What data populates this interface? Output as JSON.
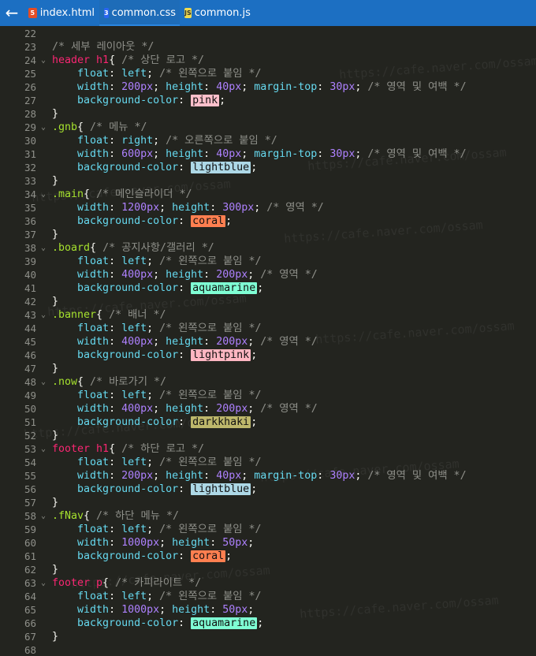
{
  "tabs": [
    {
      "label": "index.html",
      "icon": "html-file-icon",
      "type": "html"
    },
    {
      "label": "common.css",
      "icon": "css-file-icon",
      "type": "css"
    },
    {
      "label": "common.js",
      "icon": "js-file-icon",
      "type": "js"
    }
  ],
  "back_glyph": "←",
  "watermark": "https://cafe.naver.com/ossam",
  "lines": [
    {
      "n": "22",
      "fold": "",
      "seg": []
    },
    {
      "n": "23",
      "fold": "",
      "seg": [
        [
          "cmt",
          "/* 세부 레이아웃 */"
        ]
      ]
    },
    {
      "n": "24",
      "fold": "⌄",
      "seg": [
        [
          "tag",
          "header h1"
        ],
        [
          "",
          "{ "
        ],
        [
          "cmt",
          "/* 상단 로고 */"
        ]
      ]
    },
    {
      "n": "25",
      "fold": "",
      "seg": [
        [
          "",
          "    "
        ],
        [
          "prop",
          "float"
        ],
        [
          "",
          ": "
        ],
        [
          "val",
          "left"
        ],
        [
          "",
          "; "
        ],
        [
          "cmt",
          "/* 왼쪽으로 붙임 */"
        ]
      ]
    },
    {
      "n": "26",
      "fold": "",
      "seg": [
        [
          "",
          "    "
        ],
        [
          "prop",
          "width"
        ],
        [
          "",
          ": "
        ],
        [
          "num",
          "200px"
        ],
        [
          "",
          "; "
        ],
        [
          "prop",
          "height"
        ],
        [
          "",
          ": "
        ],
        [
          "num",
          "40px"
        ],
        [
          "",
          "; "
        ],
        [
          "prop",
          "margin-top"
        ],
        [
          "",
          ": "
        ],
        [
          "num",
          "30px"
        ],
        [
          "",
          "; "
        ],
        [
          "cmt",
          "/* 영역 및 여백 */"
        ]
      ]
    },
    {
      "n": "27",
      "fold": "",
      "seg": [
        [
          "",
          "    "
        ],
        [
          "prop",
          "background-color"
        ],
        [
          "",
          ": "
        ],
        [
          "sw:#ffc0cb",
          "pink"
        ],
        [
          "",
          ";"
        ]
      ]
    },
    {
      "n": "28",
      "fold": "",
      "seg": [
        [
          "",
          "}"
        ]
      ]
    },
    {
      "n": "29",
      "fold": "⌄",
      "seg": [
        [
          "cls",
          ".gnb"
        ],
        [
          "",
          "{ "
        ],
        [
          "cmt",
          "/* 메뉴 */"
        ]
      ]
    },
    {
      "n": "30",
      "fold": "",
      "seg": [
        [
          "",
          "    "
        ],
        [
          "prop",
          "float"
        ],
        [
          "",
          ": "
        ],
        [
          "val",
          "right"
        ],
        [
          "",
          "; "
        ],
        [
          "cmt",
          "/* 오른쪽으로 붙임 */"
        ]
      ]
    },
    {
      "n": "31",
      "fold": "",
      "seg": [
        [
          "",
          "    "
        ],
        [
          "prop",
          "width"
        ],
        [
          "",
          ": "
        ],
        [
          "num",
          "600px"
        ],
        [
          "",
          "; "
        ],
        [
          "prop",
          "height"
        ],
        [
          "",
          ": "
        ],
        [
          "num",
          "40px"
        ],
        [
          "",
          "; "
        ],
        [
          "prop",
          "margin-top"
        ],
        [
          "",
          ": "
        ],
        [
          "num",
          "30px"
        ],
        [
          "",
          "; "
        ],
        [
          "cmt",
          "/* 영역 및 여백 */"
        ]
      ]
    },
    {
      "n": "32",
      "fold": "",
      "seg": [
        [
          "",
          "    "
        ],
        [
          "prop",
          "background-color"
        ],
        [
          "",
          ": "
        ],
        [
          "sw:#add8e6",
          "lightblue"
        ],
        [
          "",
          ";"
        ]
      ]
    },
    {
      "n": "33",
      "fold": "",
      "seg": [
        [
          "",
          "}"
        ]
      ]
    },
    {
      "n": "34",
      "fold": "⌄",
      "seg": [
        [
          "cls",
          ".main"
        ],
        [
          "",
          "{ "
        ],
        [
          "cmt",
          "/* 메인슬라이더 */"
        ]
      ]
    },
    {
      "n": "35",
      "fold": "",
      "seg": [
        [
          "",
          "    "
        ],
        [
          "prop",
          "width"
        ],
        [
          "",
          ": "
        ],
        [
          "num",
          "1200px"
        ],
        [
          "",
          "; "
        ],
        [
          "prop",
          "height"
        ],
        [
          "",
          ": "
        ],
        [
          "num",
          "300px"
        ],
        [
          "",
          "; "
        ],
        [
          "cmt",
          "/* 영역 */"
        ]
      ]
    },
    {
      "n": "36",
      "fold": "",
      "seg": [
        [
          "",
          "    "
        ],
        [
          "prop",
          "background-color"
        ],
        [
          "",
          ": "
        ],
        [
          "sw:#ff7f50",
          "coral"
        ],
        [
          "",
          ";"
        ]
      ]
    },
    {
      "n": "37",
      "fold": "",
      "seg": [
        [
          "",
          "}"
        ]
      ]
    },
    {
      "n": "38",
      "fold": "⌄",
      "seg": [
        [
          "cls",
          ".board"
        ],
        [
          "",
          "{ "
        ],
        [
          "cmt",
          "/* 공지사항/갤러리 */"
        ]
      ]
    },
    {
      "n": "39",
      "fold": "",
      "seg": [
        [
          "",
          "    "
        ],
        [
          "prop",
          "float"
        ],
        [
          "",
          ": "
        ],
        [
          "val",
          "left"
        ],
        [
          "",
          "; "
        ],
        [
          "cmt",
          "/* 왼쪽으로 붙임 */"
        ]
      ]
    },
    {
      "n": "40",
      "fold": "",
      "seg": [
        [
          "",
          "    "
        ],
        [
          "prop",
          "width"
        ],
        [
          "",
          ": "
        ],
        [
          "num",
          "400px"
        ],
        [
          "",
          "; "
        ],
        [
          "prop",
          "height"
        ],
        [
          "",
          ": "
        ],
        [
          "num",
          "200px"
        ],
        [
          "",
          "; "
        ],
        [
          "cmt",
          "/* 영역 */"
        ]
      ]
    },
    {
      "n": "41",
      "fold": "",
      "seg": [
        [
          "",
          "    "
        ],
        [
          "prop",
          "background-color"
        ],
        [
          "",
          ": "
        ],
        [
          "sw:#7fffd4",
          "aquamarine"
        ],
        [
          "",
          ";"
        ]
      ]
    },
    {
      "n": "42",
      "fold": "",
      "seg": [
        [
          "",
          "}"
        ]
      ]
    },
    {
      "n": "43",
      "fold": "⌄",
      "seg": [
        [
          "cls",
          ".banner"
        ],
        [
          "",
          "{ "
        ],
        [
          "cmt",
          "/* 배너 */"
        ]
      ]
    },
    {
      "n": "44",
      "fold": "",
      "seg": [
        [
          "",
          "    "
        ],
        [
          "prop",
          "float"
        ],
        [
          "",
          ": "
        ],
        [
          "val",
          "left"
        ],
        [
          "",
          "; "
        ],
        [
          "cmt",
          "/* 왼쪽으로 붙임 */"
        ]
      ]
    },
    {
      "n": "45",
      "fold": "",
      "seg": [
        [
          "",
          "    "
        ],
        [
          "prop",
          "width"
        ],
        [
          "",
          ": "
        ],
        [
          "num",
          "400px"
        ],
        [
          "",
          "; "
        ],
        [
          "prop",
          "height"
        ],
        [
          "",
          ": "
        ],
        [
          "num",
          "200px"
        ],
        [
          "",
          "; "
        ],
        [
          "cmt",
          "/* 영역 */"
        ]
      ]
    },
    {
      "n": "46",
      "fold": "",
      "seg": [
        [
          "",
          "    "
        ],
        [
          "prop",
          "background-color"
        ],
        [
          "",
          ": "
        ],
        [
          "sw:#ffb6c1",
          "lightpink"
        ],
        [
          "",
          ";"
        ]
      ]
    },
    {
      "n": "47",
      "fold": "",
      "seg": [
        [
          "",
          "}"
        ]
      ]
    },
    {
      "n": "48",
      "fold": "⌄",
      "seg": [
        [
          "cls",
          ".now"
        ],
        [
          "",
          "{ "
        ],
        [
          "cmt",
          "/* 바로가기 */"
        ]
      ]
    },
    {
      "n": "49",
      "fold": "",
      "seg": [
        [
          "",
          "    "
        ],
        [
          "prop",
          "float"
        ],
        [
          "",
          ": "
        ],
        [
          "val",
          "left"
        ],
        [
          "",
          "; "
        ],
        [
          "cmt",
          "/* 왼쪽으로 붙임 */"
        ]
      ]
    },
    {
      "n": "50",
      "fold": "",
      "seg": [
        [
          "",
          "    "
        ],
        [
          "prop",
          "width"
        ],
        [
          "",
          ": "
        ],
        [
          "num",
          "400px"
        ],
        [
          "",
          "; "
        ],
        [
          "prop",
          "height"
        ],
        [
          "",
          ": "
        ],
        [
          "num",
          "200px"
        ],
        [
          "",
          "; "
        ],
        [
          "cmt",
          "/* 영역 */"
        ]
      ]
    },
    {
      "n": "51",
      "fold": "",
      "seg": [
        [
          "",
          "    "
        ],
        [
          "prop",
          "background-color"
        ],
        [
          "",
          ": "
        ],
        [
          "sw:#bdb76b",
          "darkkhaki"
        ],
        [
          "",
          ";"
        ]
      ]
    },
    {
      "n": "52",
      "fold": "",
      "seg": [
        [
          "",
          "}"
        ]
      ]
    },
    {
      "n": "53",
      "fold": "⌄",
      "seg": [
        [
          "tag",
          "footer h1"
        ],
        [
          "",
          "{ "
        ],
        [
          "cmt",
          "/* 하단 로고 */"
        ]
      ]
    },
    {
      "n": "54",
      "fold": "",
      "seg": [
        [
          "",
          "    "
        ],
        [
          "prop",
          "float"
        ],
        [
          "",
          ": "
        ],
        [
          "val",
          "left"
        ],
        [
          "",
          "; "
        ],
        [
          "cmt",
          "/* 왼쪽으로 붙임 */"
        ]
      ]
    },
    {
      "n": "55",
      "fold": "",
      "seg": [
        [
          "",
          "    "
        ],
        [
          "prop",
          "width"
        ],
        [
          "",
          ": "
        ],
        [
          "num",
          "200px"
        ],
        [
          "",
          "; "
        ],
        [
          "prop",
          "height"
        ],
        [
          "",
          ": "
        ],
        [
          "num",
          "40px"
        ],
        [
          "",
          "; "
        ],
        [
          "prop",
          "margin-top"
        ],
        [
          "",
          ": "
        ],
        [
          "num",
          "30px"
        ],
        [
          "",
          "; "
        ],
        [
          "cmt",
          "/* 영역 및 여백 */"
        ]
      ]
    },
    {
      "n": "56",
      "fold": "",
      "seg": [
        [
          "",
          "    "
        ],
        [
          "prop",
          "background-color"
        ],
        [
          "",
          ": "
        ],
        [
          "sw:#add8e6",
          "lightblue"
        ],
        [
          "",
          ";"
        ]
      ]
    },
    {
      "n": "57",
      "fold": "",
      "seg": [
        [
          "",
          "}"
        ]
      ]
    },
    {
      "n": "58",
      "fold": "⌄",
      "seg": [
        [
          "cls",
          ".fNav"
        ],
        [
          "",
          "{ "
        ],
        [
          "cmt",
          "/* 하단 메뉴 */"
        ]
      ]
    },
    {
      "n": "59",
      "fold": "",
      "seg": [
        [
          "",
          "    "
        ],
        [
          "prop",
          "float"
        ],
        [
          "",
          ": "
        ],
        [
          "val",
          "left"
        ],
        [
          "",
          "; "
        ],
        [
          "cmt",
          "/* 왼쪽으로 붙임 */"
        ]
      ]
    },
    {
      "n": "60",
      "fold": "",
      "seg": [
        [
          "",
          "    "
        ],
        [
          "prop",
          "width"
        ],
        [
          "",
          ": "
        ],
        [
          "num",
          "1000px"
        ],
        [
          "",
          "; "
        ],
        [
          "prop",
          "height"
        ],
        [
          "",
          ": "
        ],
        [
          "num",
          "50px"
        ],
        [
          "",
          ";"
        ]
      ]
    },
    {
      "n": "61",
      "fold": "",
      "seg": [
        [
          "",
          "    "
        ],
        [
          "prop",
          "background-color"
        ],
        [
          "",
          ": "
        ],
        [
          "sw:#ff7f50",
          "coral"
        ],
        [
          "",
          ";"
        ]
      ]
    },
    {
      "n": "62",
      "fold": "",
      "seg": [
        [
          "",
          "}"
        ]
      ]
    },
    {
      "n": "63",
      "fold": "⌄",
      "seg": [
        [
          "tag",
          "footer p"
        ],
        [
          "",
          "{ "
        ],
        [
          "cmt",
          "/* 카피라이트 */"
        ]
      ]
    },
    {
      "n": "64",
      "fold": "",
      "seg": [
        [
          "",
          "    "
        ],
        [
          "prop",
          "float"
        ],
        [
          "",
          ": "
        ],
        [
          "val",
          "left"
        ],
        [
          "",
          "; "
        ],
        [
          "cmt",
          "/* 왼쪽으로 붙임 */"
        ]
      ]
    },
    {
      "n": "65",
      "fold": "",
      "seg": [
        [
          "",
          "    "
        ],
        [
          "prop",
          "width"
        ],
        [
          "",
          ": "
        ],
        [
          "num",
          "1000px"
        ],
        [
          "",
          "; "
        ],
        [
          "prop",
          "height"
        ],
        [
          "",
          ": "
        ],
        [
          "num",
          "50px"
        ],
        [
          "",
          ";"
        ]
      ]
    },
    {
      "n": "66",
      "fold": "",
      "seg": [
        [
          "",
          "    "
        ],
        [
          "prop",
          "background-color"
        ],
        [
          "",
          ": "
        ],
        [
          "sw:#7fffd4",
          "aquamarine"
        ],
        [
          "",
          ";"
        ]
      ]
    },
    {
      "n": "67",
      "fold": "",
      "seg": [
        [
          "",
          "}"
        ]
      ]
    },
    {
      "n": "68",
      "fold": "",
      "seg": []
    }
  ]
}
